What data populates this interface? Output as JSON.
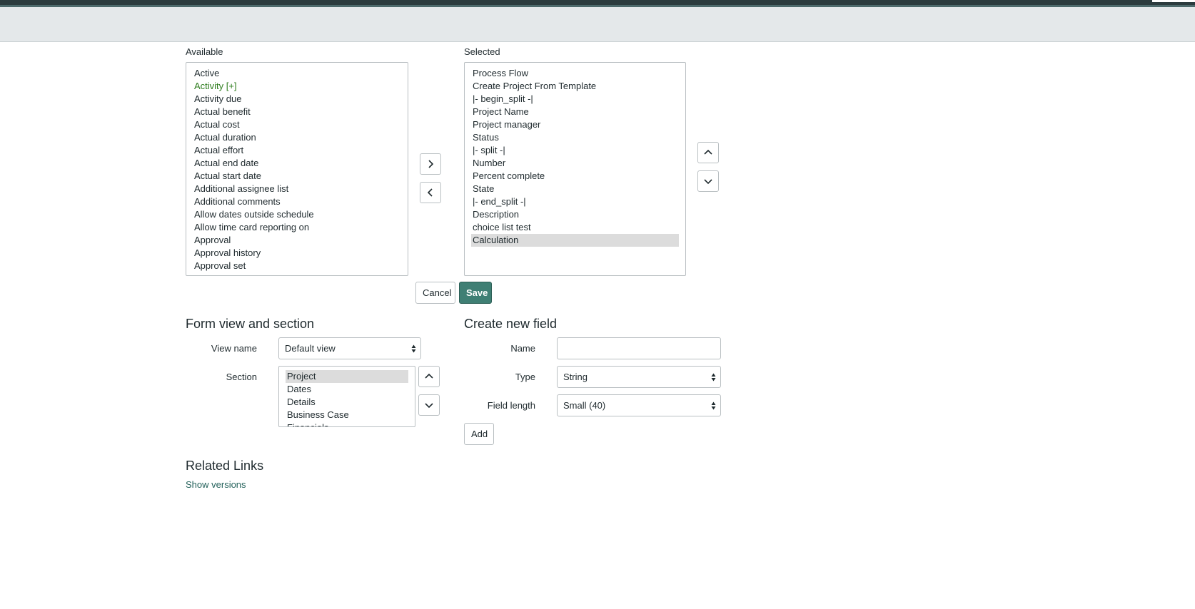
{
  "slushbucket": {
    "available_label": "Available",
    "selected_label": "Selected",
    "available_items": [
      {
        "label": "Active"
      },
      {
        "label": "Activity [+]",
        "style": "green"
      },
      {
        "label": "Activity due"
      },
      {
        "label": "Actual benefit"
      },
      {
        "label": "Actual cost"
      },
      {
        "label": "Actual duration"
      },
      {
        "label": "Actual effort"
      },
      {
        "label": "Actual end date"
      },
      {
        "label": "Actual start date"
      },
      {
        "label": "Additional assignee list"
      },
      {
        "label": "Additional comments"
      },
      {
        "label": "Allow dates outside schedule"
      },
      {
        "label": "Allow time card reporting on"
      },
      {
        "label": "Approval"
      },
      {
        "label": "Approval history"
      },
      {
        "label": "Approval set"
      }
    ],
    "selected_items": [
      {
        "label": "Process Flow"
      },
      {
        "label": "Create Project From Template"
      },
      {
        "label": "|- begin_split -|"
      },
      {
        "label": "Project Name"
      },
      {
        "label": "Project manager"
      },
      {
        "label": "Status"
      },
      {
        "label": "|- split -|"
      },
      {
        "label": "Number"
      },
      {
        "label": "Percent complete"
      },
      {
        "label": "State"
      },
      {
        "label": "|- end_split -|"
      },
      {
        "label": "Description"
      },
      {
        "label": "choice list test"
      },
      {
        "label": "Calculation",
        "selected": true
      }
    ]
  },
  "actions": {
    "cancel_label": "Cancel",
    "save_label": "Save"
  },
  "form_view": {
    "heading": "Form view and section",
    "view_name_label": "View name",
    "view_name_value": "Default view",
    "section_label": "Section",
    "sections": [
      {
        "label": "Project",
        "selected": true
      },
      {
        "label": "Dates"
      },
      {
        "label": "Details"
      },
      {
        "label": "Business Case"
      },
      {
        "label": "Financials"
      }
    ]
  },
  "create_field": {
    "heading": "Create new field",
    "name_label": "Name",
    "name_value": "",
    "type_label": "Type",
    "type_value": "String",
    "field_length_label": "Field length",
    "field_length_value": "Small (40)",
    "add_label": "Add"
  },
  "related": {
    "heading": "Related Links",
    "show_versions_label": "Show versions"
  },
  "colors": {
    "primary_button": "#3f7f74",
    "link": "#23615a",
    "highlight_item": "#2e7d1e",
    "header_bar": "#2b3b3e",
    "sub_bar": "#e4e8ea"
  },
  "icons": [
    "chevron-right-icon",
    "chevron-left-icon",
    "chevron-up-icon",
    "chevron-down-icon",
    "select-arrows-icon"
  ]
}
